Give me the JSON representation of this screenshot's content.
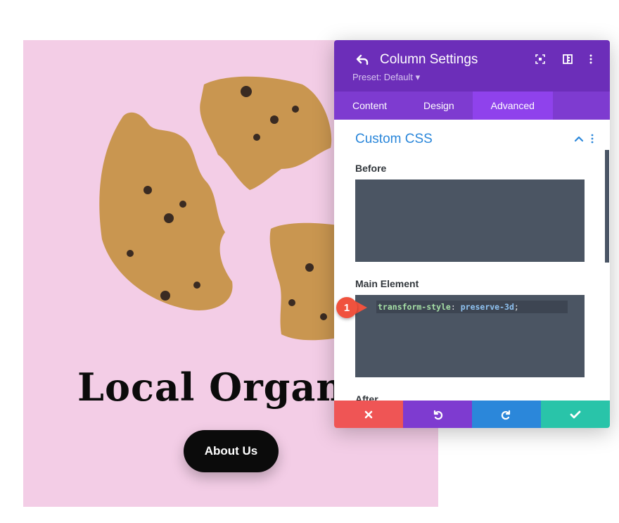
{
  "page": {
    "heading": "Local Organi",
    "button_label": "About Us"
  },
  "modal": {
    "title": "Column Settings",
    "preset": "Preset: Default ▾",
    "tabs": [
      {
        "label": "Content"
      },
      {
        "label": "Design"
      },
      {
        "label": "Advanced"
      }
    ],
    "active_tab": "Advanced",
    "section_title": "Custom CSS",
    "fields": {
      "before_label": "Before",
      "main_label": "Main Element",
      "after_label": "After"
    },
    "code": {
      "property": "transform-style",
      "separator": ": ",
      "value": "preserve-3d",
      "terminator": ";"
    },
    "badge": "1"
  },
  "colors": {
    "header": "#6c2eb9",
    "tabs": "#7e3bd0",
    "active_tab": "#8f42ec",
    "accent_blue": "#2b87da",
    "code_bg": "#4b5563",
    "cancel": "#ef5555",
    "undo": "#7e3bd0",
    "redo": "#2b87da",
    "save": "#29c4a9",
    "section_bg": "#f3cde6"
  },
  "icons": [
    "undo-arrow-icon",
    "focus-icon",
    "split-view-icon",
    "more-vertical-icon",
    "chevron-up-icon",
    "close-icon",
    "undo-icon",
    "redo-icon",
    "check-icon"
  ]
}
